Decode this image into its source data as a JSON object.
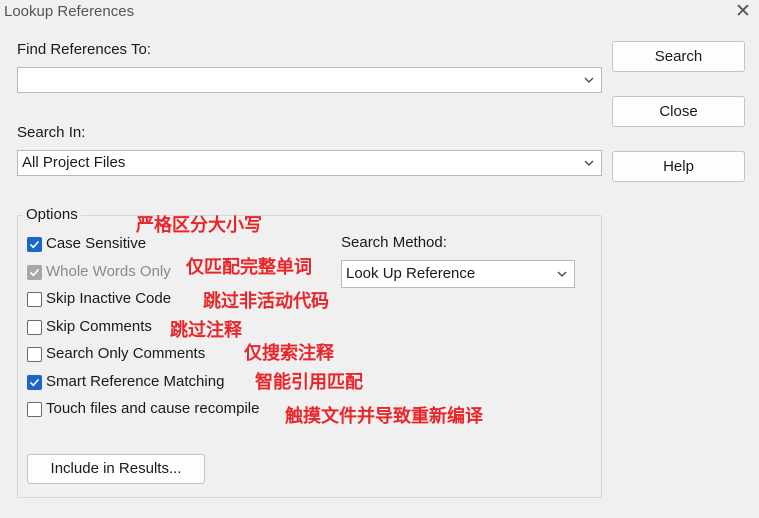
{
  "window": {
    "title": "Lookup References",
    "close_glyph": "✕"
  },
  "find": {
    "label": "Find References To:",
    "value": ""
  },
  "search_in": {
    "label": "Search In:",
    "value": "All Project Files"
  },
  "buttons": {
    "search": "Search",
    "close": "Close",
    "help": "Help",
    "include": "Include in Results..."
  },
  "options": {
    "label": "Options",
    "items": [
      {
        "label": "Case Sensitive",
        "checked": true,
        "enabled": true,
        "annotation": "严格区分大小写"
      },
      {
        "label": "Whole Words Only",
        "checked": true,
        "enabled": false,
        "annotation": "仅匹配完整单词"
      },
      {
        "label": "Skip Inactive Code",
        "checked": false,
        "enabled": true,
        "annotation": "跳过非活动代码"
      },
      {
        "label": "Skip Comments",
        "checked": false,
        "enabled": true,
        "annotation": "跳过注释"
      },
      {
        "label": "Search Only Comments",
        "checked": false,
        "enabled": true,
        "annotation": "仅搜索注释"
      },
      {
        "label": "Smart Reference Matching",
        "checked": true,
        "enabled": true,
        "annotation": "智能引用匹配"
      },
      {
        "label": "Touch files and cause recompile",
        "checked": false,
        "enabled": true,
        "annotation": "触摸文件并导致重新编译"
      }
    ],
    "method_label": "Search Method:",
    "method_value": "Look Up Reference"
  },
  "colors": {
    "annotation": "#e8262a",
    "checkbox_accent": "#1b66c9"
  },
  "icons": {
    "dropdown": "chevron-down-icon",
    "check": "checkmark-icon",
    "close": "close-icon"
  }
}
